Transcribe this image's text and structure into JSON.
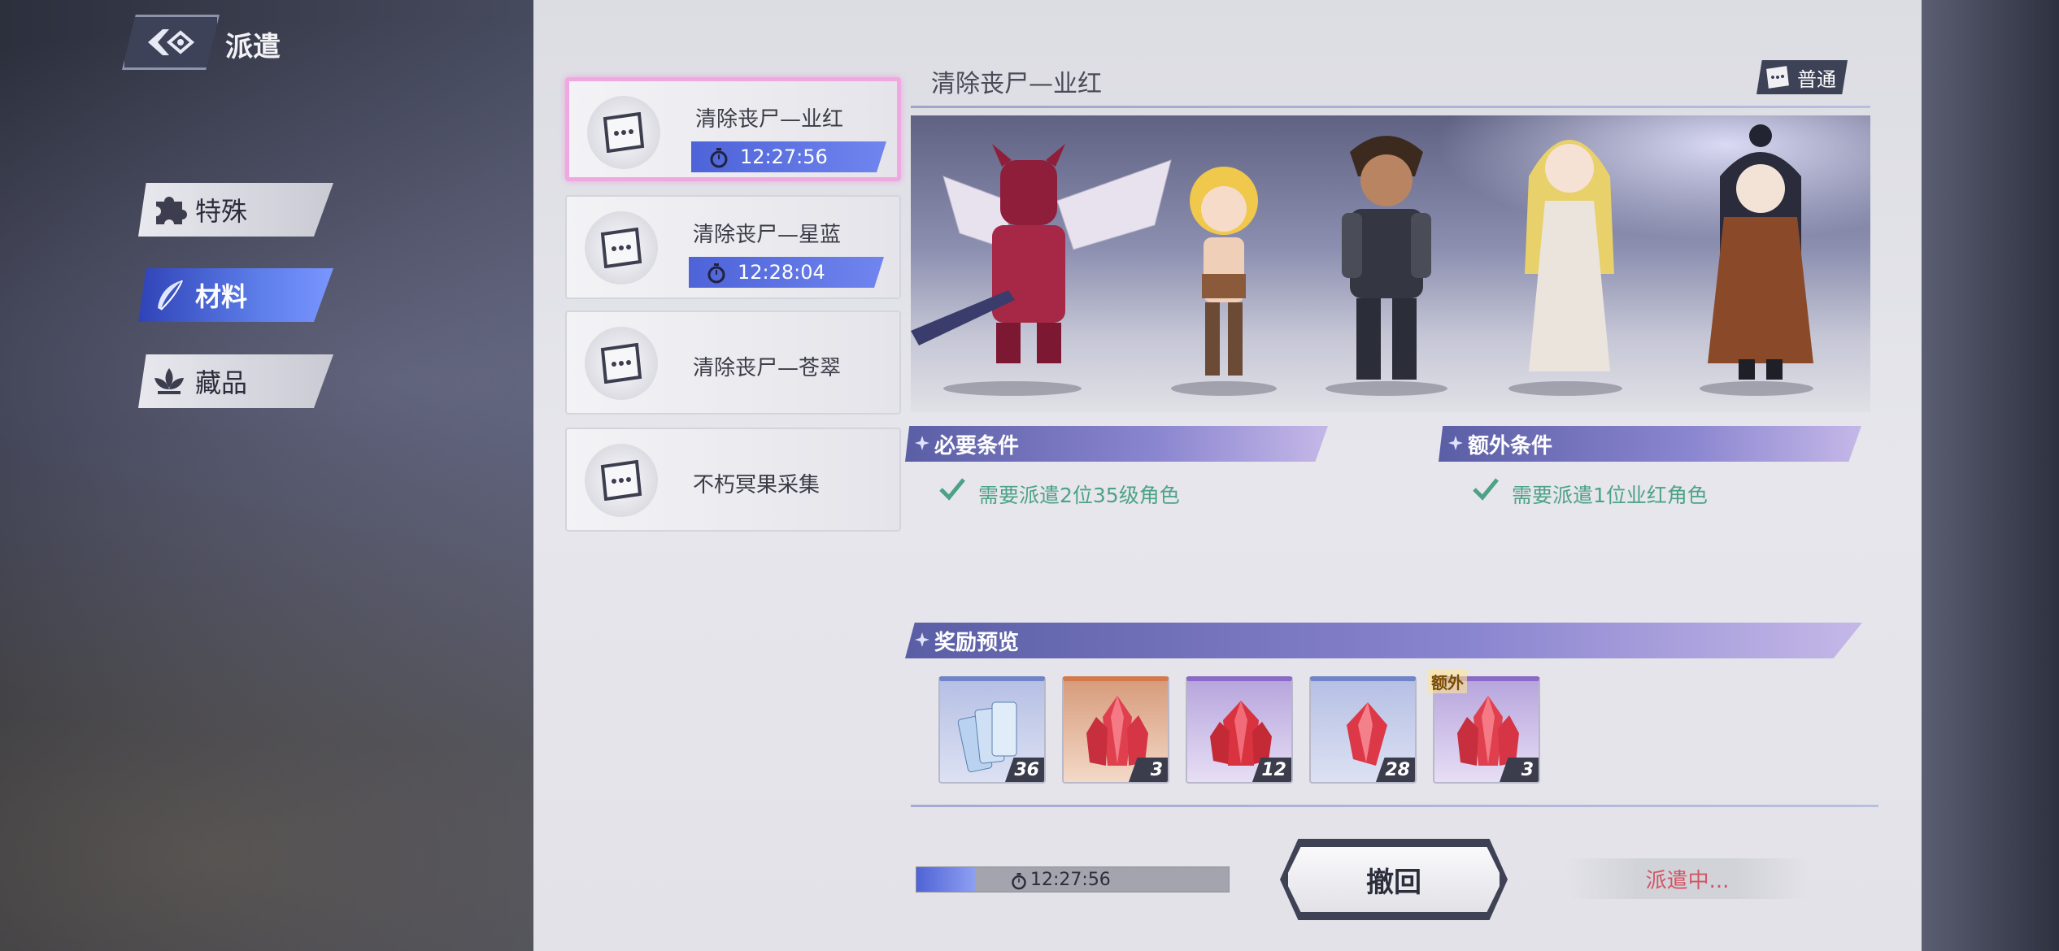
{
  "header": {
    "title": "派遣",
    "back_icon": "back-arrow-icon"
  },
  "categories": [
    {
      "label": "特殊",
      "icon": "puzzle-icon",
      "active": false
    },
    {
      "label": "材料",
      "icon": "feather-icon",
      "active": true
    },
    {
      "label": "藏品",
      "icon": "lotus-icon",
      "active": false
    }
  ],
  "tasks": [
    {
      "name": "清除丧尸—业红",
      "timer": "12:27:56",
      "selected": true
    },
    {
      "name": "清除丧尸—星蓝",
      "timer": "12:28:04",
      "selected": false
    },
    {
      "name": "清除丧尸—苍翠",
      "selected": false
    },
    {
      "name": "不朽冥果采集",
      "selected": false
    }
  ],
  "mission": {
    "title": "清除丧尸—业红",
    "difficulty": "普通",
    "required": {
      "label": "必要条件",
      "condition": "需要派遣2位35级角色"
    },
    "extra": {
      "label": "额外条件",
      "condition": "需要派遣1位业红角色"
    }
  },
  "rewards": {
    "label": "奖励预览",
    "extra_tag": "额外",
    "items": [
      {
        "icon": "ticket-stack-icon",
        "qty": "36",
        "rarity": "blue"
      },
      {
        "icon": "red-crystal-large-icon",
        "qty": "3",
        "rarity": "orange"
      },
      {
        "icon": "red-crystal-medium-icon",
        "qty": "12",
        "rarity": "purple"
      },
      {
        "icon": "red-crystal-small-icon",
        "qty": "28",
        "rarity": "blue"
      },
      {
        "icon": "red-crystal-large-icon",
        "qty": "3",
        "rarity": "purple"
      }
    ]
  },
  "footer": {
    "progress_time": "12:27:56",
    "progress_fraction": 0.19,
    "recall_label": "撤回",
    "status": "派遣中..."
  },
  "colors": {
    "accent": "#5b6fe0",
    "selected_border": "#f0a8e0",
    "condition_ok": "#4da286",
    "status_text": "#d25563"
  }
}
